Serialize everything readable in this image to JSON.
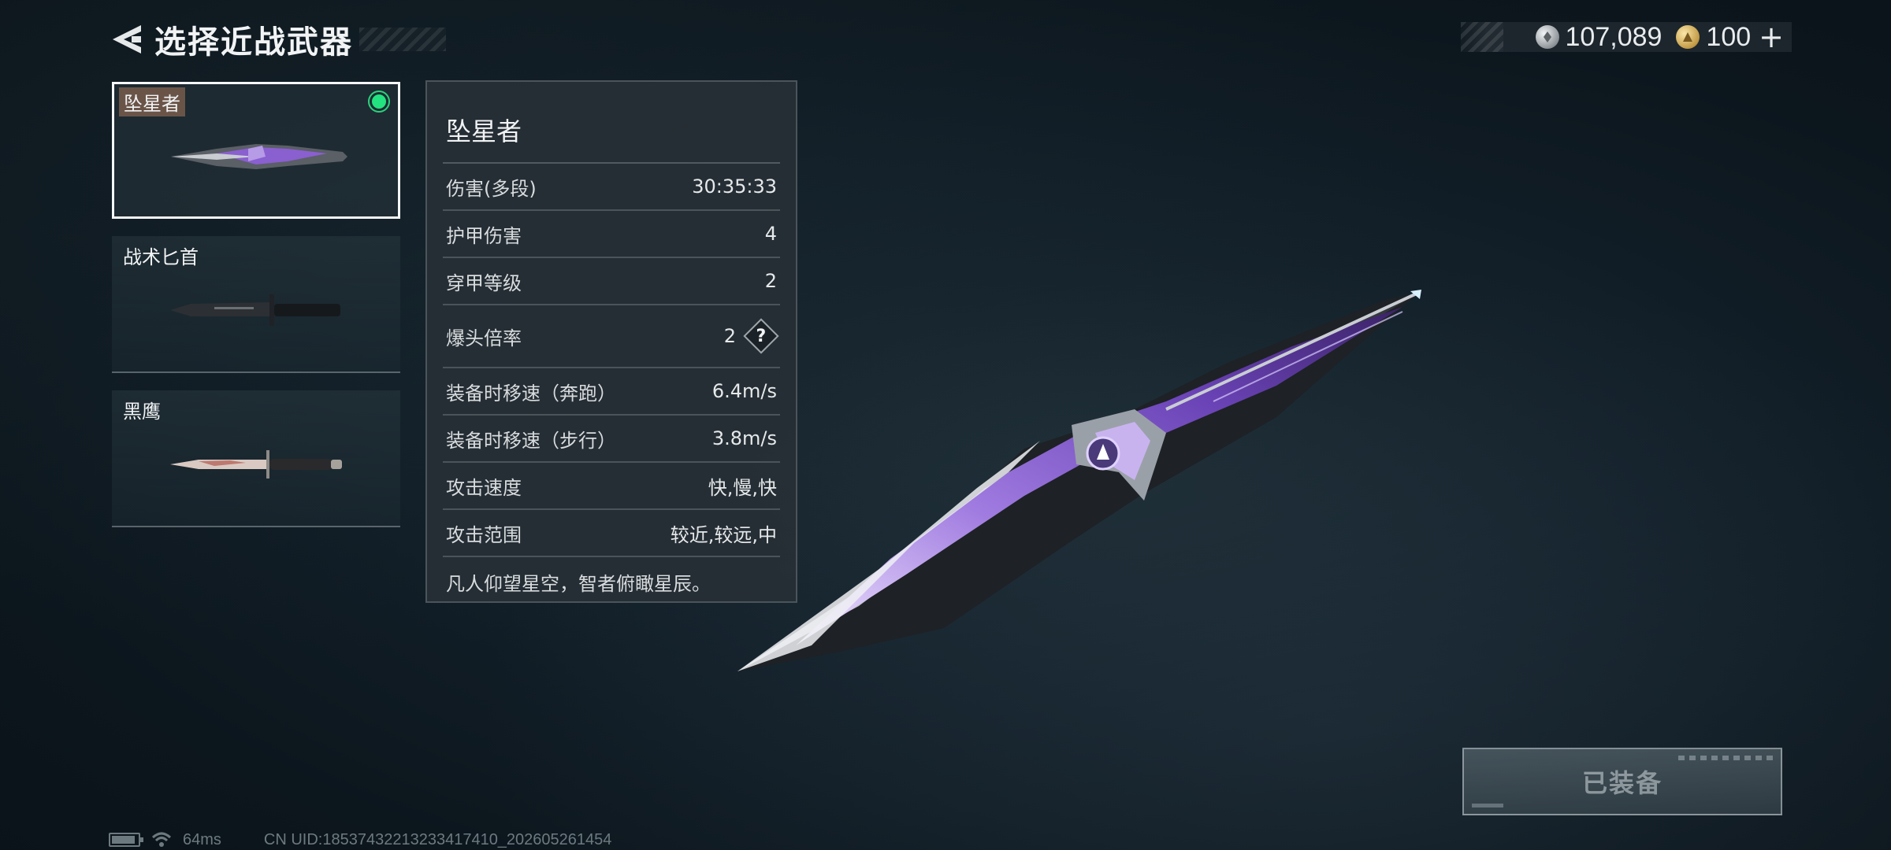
{
  "header": {
    "title": "选择近战武器"
  },
  "currency": {
    "silver_amount": "107,089",
    "gold_amount": "100",
    "gold_suffix": "+"
  },
  "weapon_list": [
    {
      "name": "坠星者",
      "selected": true,
      "equipped": true
    },
    {
      "name": "战术匕首",
      "selected": false,
      "equipped": false
    },
    {
      "name": "黑鹰",
      "selected": false,
      "equipped": false
    }
  ],
  "stats": {
    "weapon_name": "坠星者",
    "rows": [
      {
        "label": "伤害(多段)",
        "value": "30:35:33"
      },
      {
        "label": "护甲伤害",
        "value": "4"
      },
      {
        "label": "穿甲等级",
        "value": "2"
      },
      {
        "label": "爆头倍率",
        "value": "2"
      },
      {
        "label": "装备时移速（奔跑）",
        "value": "6.4m/s"
      },
      {
        "label": "装备时移速（步行）",
        "value": "3.8m/s"
      },
      {
        "label": "攻击速度",
        "value": "快,慢,快"
      },
      {
        "label": "攻击范围",
        "value": "较近,较远,中"
      }
    ],
    "help_glyph": "?",
    "description": "凡人仰望星空，智者俯瞰星辰。"
  },
  "equip_button": {
    "label": "已装备"
  },
  "status_bar": {
    "ping": "64ms",
    "uid": "CN UID:18537432213233417410_202605261454"
  },
  "colors": {
    "equipped_indicator": "#22e37f",
    "selected_border": "#f4f6f7",
    "blade_accent": "#8a5fd0"
  }
}
